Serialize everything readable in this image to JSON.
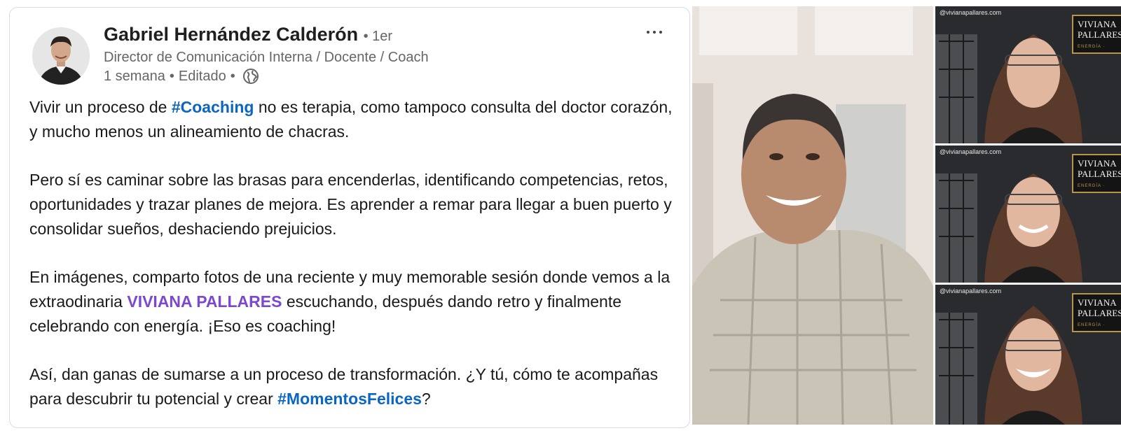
{
  "post": {
    "author": {
      "name": "Gabriel Hernández Calderón",
      "degree": "• 1er",
      "headline": "Director de Comunicación Interna / Docente / Coach"
    },
    "meta": {
      "time": "1 semana",
      "separator1": "•",
      "edited": "Editado",
      "separator2": "•",
      "visibility_icon": "globe-icon"
    },
    "more_icon": "more-horizontal-icon",
    "body": {
      "p1": {
        "t1": "Vivir un proceso de ",
        "hashtag": "#Coaching",
        "t2": " no es terapia, como tampoco consulta del doctor corazón, y mucho menos un alineamiento de chacras."
      },
      "p2": {
        "text": "Pero sí es caminar sobre las brasas para encenderlas, identificando competencias, retos, oportunidades y trazar planes de mejora. Es aprender a remar para llegar a buen puerto y consolidar sueños, deshaciendo prejuicios."
      },
      "p3": {
        "t1": "En imágenes, comparto fotos de una reciente y muy memorable sesión donde vemos a la extraodinaria ",
        "mention": "VIVIANA PALLARES",
        "t2": " escuchando, después dando retro y finalmente celebrando con energía. ¡Eso es coaching!"
      },
      "p4": {
        "t1": "Así, dan ganas de sumarse a un proceso de transformación. ¿Y tú, cómo te acompañas para descubrir tu potencial y crear ",
        "hashtag": "#MomentosFelices",
        "t2": "?"
      }
    }
  },
  "media": {
    "watermark": "@vivianapallares.com",
    "brand_line1": "VIVIANA",
    "brand_line2": "PALLARES",
    "brand_tagline": "ENERGÍA · ALTERNATIVAS"
  },
  "colors": {
    "hashtag": "#0a66c2",
    "mention": "#7b47d4",
    "secondary_text": "#666666",
    "brand_gold": "#b9954a"
  }
}
